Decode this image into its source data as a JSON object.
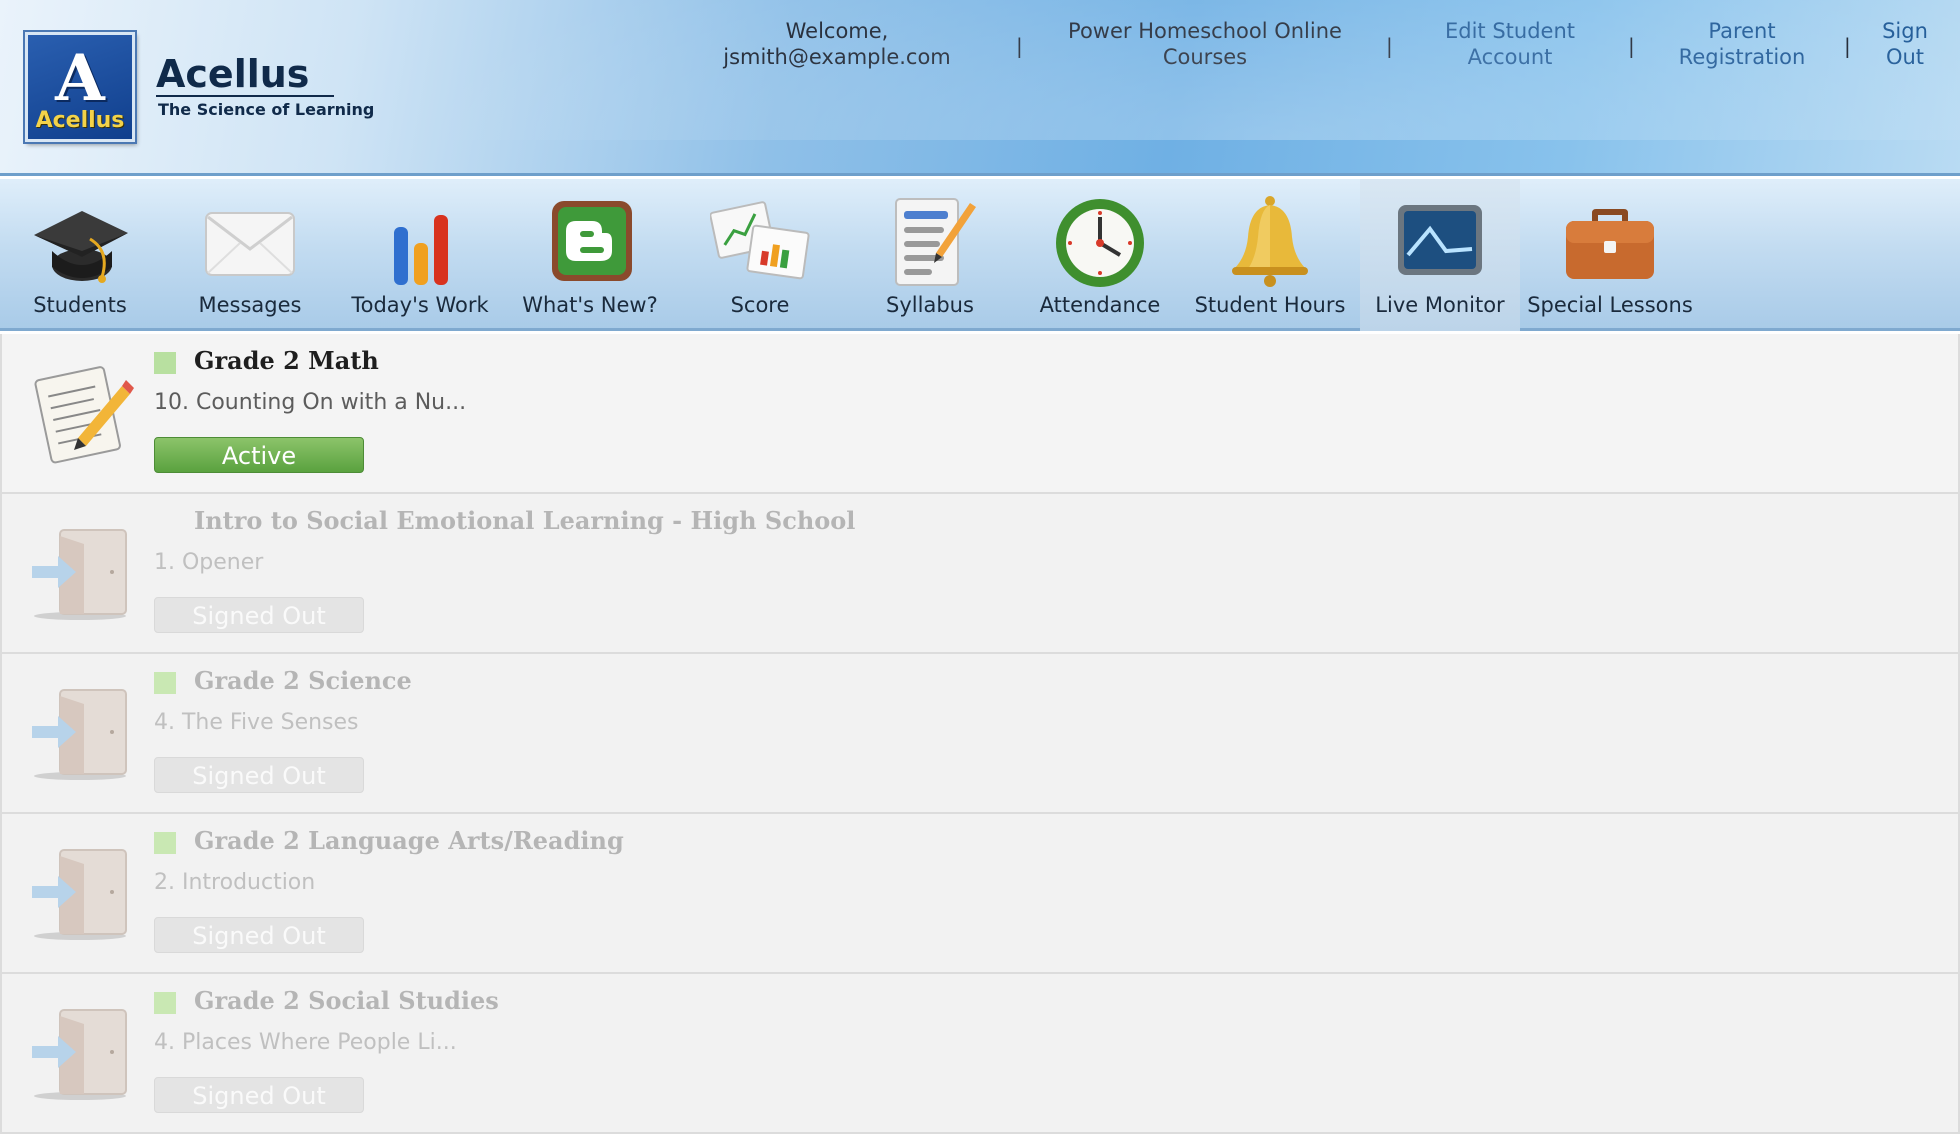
{
  "brand": {
    "logo_letter": "A",
    "logo_label": "Acellus",
    "name": "Acellus",
    "tagline": "The Science of Learning"
  },
  "topnav": {
    "welcome_line1": "Welcome,",
    "welcome_line2": "jsmith@example.com",
    "courses_line1": "Power Homeschool Online",
    "courses_line2": "Courses",
    "edit_line1": "Edit Student",
    "edit_line2": "Account",
    "parent_line1": "Parent",
    "parent_line2": "Registration",
    "signout_line1": "Sign",
    "signout_line2": "Out",
    "separator": "|"
  },
  "toolbar": [
    {
      "label": "Students",
      "icon": "graduation-cap-icon"
    },
    {
      "label": "Messages",
      "icon": "envelope-icon"
    },
    {
      "label": "Today's Work",
      "icon": "bar-chart-icon"
    },
    {
      "label": "What's New?",
      "icon": "blogger-icon"
    },
    {
      "label": "Score",
      "icon": "score-charts-icon"
    },
    {
      "label": "Syllabus",
      "icon": "syllabus-icon"
    },
    {
      "label": "Attendance",
      "icon": "clock-icon"
    },
    {
      "label": "Student Hours",
      "icon": "bell-icon"
    },
    {
      "label": "Live Monitor",
      "icon": "monitor-icon"
    },
    {
      "label": "Special Lessons",
      "icon": "briefcase-icon"
    }
  ],
  "courses": [
    {
      "title": "Grade 2 Math",
      "lesson": "10. Counting On with a Nu...",
      "status": "Active",
      "icon": "worksheet-pencil-icon",
      "square": true
    },
    {
      "title": "Intro to Social Emotional Learning - High School",
      "lesson": "1. Opener",
      "status": "Signed Out",
      "icon": "exit-door-icon",
      "square": false
    },
    {
      "title": "Grade 2 Science",
      "lesson": "4. The Five Senses",
      "status": "Signed Out",
      "icon": "exit-door-icon",
      "square": true
    },
    {
      "title": "Grade 2 Language Arts/Reading",
      "lesson": "2. Introduction",
      "status": "Signed Out",
      "icon": "exit-door-icon",
      "square": true
    },
    {
      "title": "Grade 2 Social Studies",
      "lesson": "4. Places Where People Li...",
      "status": "Signed Out",
      "icon": "exit-door-icon",
      "square": true
    }
  ],
  "colors": {
    "active_green": "#6fb44f",
    "header_blue": "#6fb0e4",
    "link_blue": "#1f5a97"
  }
}
